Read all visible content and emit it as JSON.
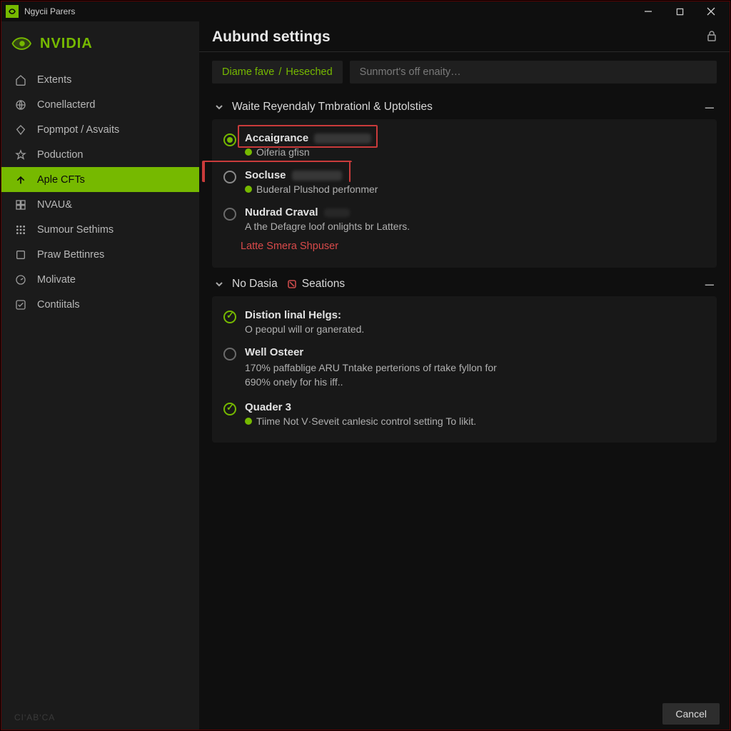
{
  "window": {
    "app_title": "Ngycii Parers"
  },
  "brand": {
    "word": "NVIDIA"
  },
  "sidebar": {
    "items": [
      {
        "label": "Extents",
        "icon": "home-icon"
      },
      {
        "label": "Conellacterd",
        "icon": "globe-icon"
      },
      {
        "label": "Fopmpot / Asvaits",
        "icon": "diamond-icon"
      },
      {
        "label": "Poduction",
        "icon": "star-icon"
      },
      {
        "label": "Aple CFTs",
        "icon": "arrow-up-icon"
      },
      {
        "label": "NVAU&",
        "icon": "grid4-icon"
      },
      {
        "label": "Sumour Sethims",
        "icon": "grid9-icon"
      },
      {
        "label": "Praw Bettinres",
        "icon": "square-icon"
      },
      {
        "label": "Molivate",
        "icon": "gauge-icon"
      },
      {
        "label": "Contiitals",
        "icon": "check-icon"
      }
    ],
    "active_index": 4,
    "footer": "CIʹABʹCA"
  },
  "page": {
    "title": "Aubund settings",
    "crumb_a": "Diame fave",
    "crumb_b": "Heseched",
    "search_placeholder": "Sunmort's off enaity…"
  },
  "section1": {
    "header": "Waite  Reyendaly  Tmbrationl  &  Uptolsties",
    "warn": "Latte Smera Shpuser",
    "options": [
      {
        "title": "Accaigrance",
        "sub": "Oiferia gfisn",
        "sub_dot": true
      },
      {
        "title": "Socluse",
        "sub": "Buderal Plushod perfonmer",
        "sub_dot": true
      },
      {
        "title": "Nudrad Craval",
        "sub": "A the Defagre loof onlights br Latters.",
        "sub_dot": false
      }
    ]
  },
  "section2": {
    "header_a": "No Dasia",
    "header_b": "Seations",
    "options": [
      {
        "title": "Distion linal Helgs:",
        "sub": "O peopul will or ganerated."
      },
      {
        "title": "Well Osteer",
        "sub": "170% paffablige ARU Tntake perterions of rtake fyllon for 690% onely for his iff.."
      },
      {
        "title": "Quader 3",
        "sub": "Tiime Not V·Seveit canlesic control setting To likit.",
        "sub_dot": true
      }
    ]
  },
  "buttons": {
    "cancel": "Cancel"
  }
}
